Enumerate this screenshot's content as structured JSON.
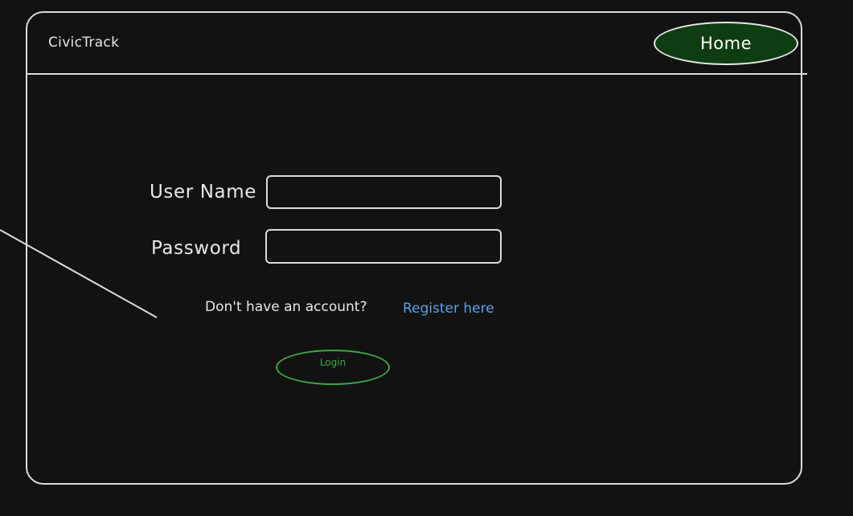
{
  "app": {
    "brand": "CivicTrack",
    "nav": {
      "home_label": "Home"
    }
  },
  "login_form": {
    "username": {
      "label": "User Name",
      "value": "",
      "placeholder": ""
    },
    "password": {
      "label": "Password",
      "value": "",
      "placeholder": ""
    },
    "register_prompt": "Don't have an account?",
    "register_link": "Register here",
    "login_button": "Login"
  },
  "colors": {
    "background": "#121212",
    "outline": "#dcdcdc",
    "home_button_fill": "#0f3d12",
    "login_button": "#3aa845",
    "link": "#5aa2e6"
  }
}
